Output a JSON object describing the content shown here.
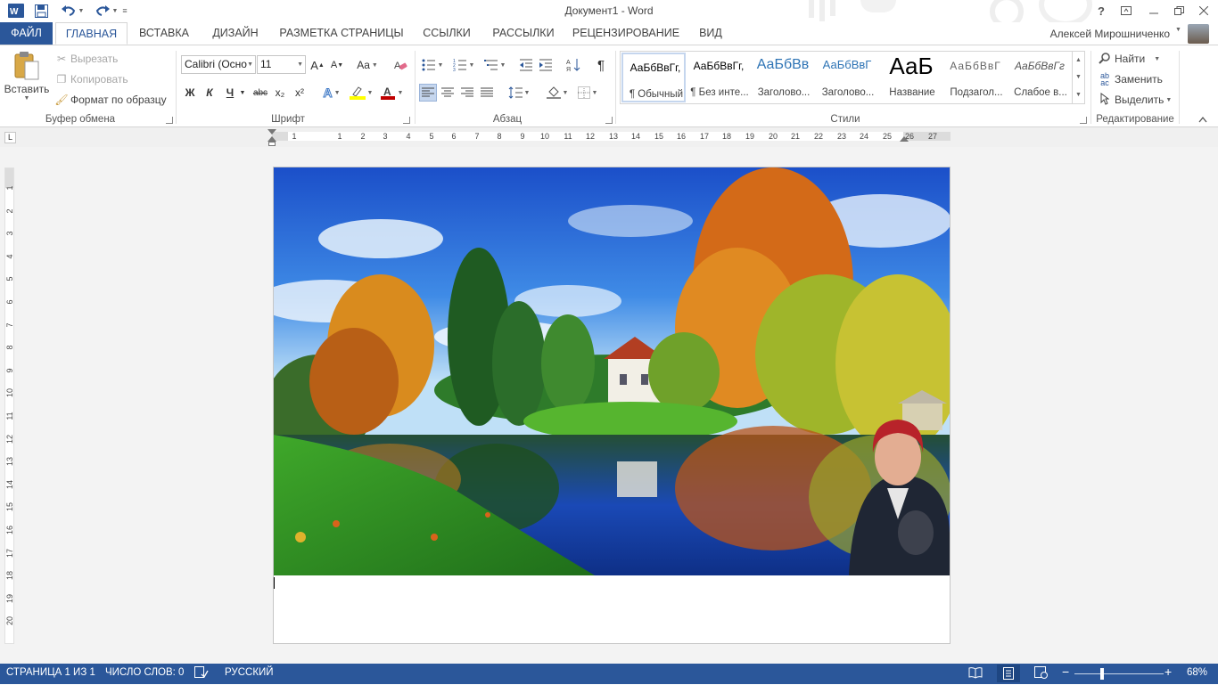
{
  "titlebar": {
    "title": "Документ1 - Word",
    "help": "?",
    "qa_icons": [
      "word-logo-icon",
      "save-icon",
      "undo-icon",
      "redo-icon",
      "customize-icon"
    ]
  },
  "tabs": {
    "file": "ФАЙЛ",
    "home": "ГЛАВНАЯ",
    "insert": "ВСТАВКА",
    "design": "ДИЗАЙН",
    "layout": "РАЗМЕТКА СТРАНИЦЫ",
    "references": "ССЫЛКИ",
    "mailings": "РАССЫЛКИ",
    "review": "РЕЦЕНЗИРОВАНИЕ",
    "view": "ВИД"
  },
  "user": {
    "name": "Алексей Мирошниченко"
  },
  "clipboard": {
    "paste": "Вставить",
    "cut": "Вырезать",
    "copy": "Копировать",
    "format_painter": "Формат по образцу",
    "label": "Буфер обмена"
  },
  "font": {
    "name": "Calibri (Осно",
    "size": "11",
    "bold": "Ж",
    "italic": "К",
    "underline": "Ч",
    "strike": "abc",
    "subscript": "x₂",
    "superscript": "x²",
    "grow": "A",
    "shrink": "A",
    "case": "Aa",
    "label": "Шрифт"
  },
  "paragraph": {
    "label": "Абзац",
    "pilcrow": "¶"
  },
  "styles": {
    "label": "Стили",
    "items": [
      {
        "preview": "АаБбВвГг,",
        "name": "¶ Обычный"
      },
      {
        "preview": "АаБбВвГг,",
        "name": "¶ Без инте..."
      },
      {
        "preview": "АаБбВв",
        "name": "Заголово..."
      },
      {
        "preview": "АаБбВвГ",
        "name": "Заголово..."
      },
      {
        "preview": "АаБ",
        "name": "Название"
      },
      {
        "preview": "АаБбВвГ",
        "name": "Подзагол..."
      },
      {
        "preview": "АаБбВвГг",
        "name": "Слабое в..."
      }
    ]
  },
  "editing": {
    "find": "Найти",
    "replace": "Заменить",
    "select": "Выделить",
    "label": "Редактирование"
  },
  "ruler": {
    "h_numbers": [
      "1",
      "1",
      "2",
      "3",
      "4",
      "5",
      "6",
      "7",
      "8",
      "9",
      "10",
      "11",
      "12",
      "13",
      "14",
      "15",
      "16",
      "17",
      "18",
      "19",
      "20",
      "21",
      "22",
      "23",
      "24",
      "25",
      "26",
      "27"
    ],
    "v_numbers": [
      "1",
      "2",
      "3",
      "4",
      "5",
      "6",
      "7",
      "8",
      "9",
      "10",
      "11",
      "12",
      "13",
      "14",
      "15",
      "16",
      "17",
      "18",
      "19",
      "20"
    ],
    "tab_stop": "L"
  },
  "status": {
    "page": "СТРАНИЦА 1 ИЗ 1",
    "words": "ЧИСЛО СЛОВ: 0",
    "language": "РУССКИЙ",
    "zoom": "68%",
    "zoom_level": 0.68
  },
  "colors": {
    "accent": "#2b579a",
    "highlight": "#ffff00",
    "font_color": "#c00000"
  }
}
